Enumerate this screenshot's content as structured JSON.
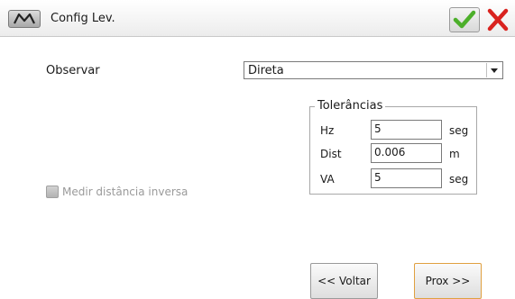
{
  "titlebar": {
    "menu_icon": "m-logo-icon",
    "title": "Config Lev.",
    "ok_icon": "checkmark-icon",
    "close_icon": "close-icon",
    "colors": {
      "check": "#4caf2a",
      "close": "#d9231f"
    }
  },
  "form": {
    "observar_label": "Observar",
    "observar_value": "Direta",
    "dropdown_icon": "chevron-down-icon"
  },
  "tolerancias": {
    "legend": "Tolerâncias",
    "rows": [
      {
        "label": "Hz",
        "value": "5",
        "unit": "seg"
      },
      {
        "label": "Dist",
        "value": "0.006",
        "unit": "m"
      },
      {
        "label": "VA",
        "value": "5",
        "unit": "seg"
      }
    ]
  },
  "options": {
    "medir_label": "Medir distância inversa",
    "medir_checked": false,
    "medir_enabled": false
  },
  "buttons": {
    "back": "<< Voltar",
    "next": "Prox >>",
    "accent": "#e0a040"
  }
}
